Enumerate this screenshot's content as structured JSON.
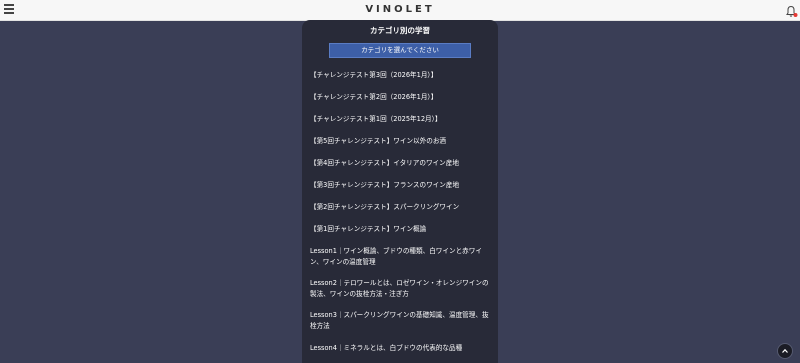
{
  "header": {
    "title": "VINOLET",
    "menu_icon": "hamburger-menu-icon",
    "bell_icon": "notification-bell-icon",
    "bell_badge_color": "#e53935"
  },
  "panel": {
    "title": "カテゴリ別の学習",
    "select_label": "カテゴリを選んでください",
    "accent_color": "#3d5fa8",
    "items": [
      {
        "label": "【チャレンジテスト第3回（2026年1月）】"
      },
      {
        "label": "【チャレンジテスト第2回（2026年1月）】"
      },
      {
        "label": "【チャレンジテスト第1回（2025年12月）】"
      },
      {
        "label": "【第5回チャレンジテスト】ワイン以外のお酒"
      },
      {
        "label": "【第4回チャレンジテスト】イタリアのワイン産地"
      },
      {
        "label": "【第3回チャレンジテスト】フランスのワイン産地"
      },
      {
        "label": "【第2回チャレンジテスト】スパークリングワイン"
      },
      {
        "label": "【第1回チャレンジテスト】ワイン概論"
      },
      {
        "label": "Lesson1｜ワイン概論、ブドウの種類、白ワインと赤ワイン、ワインの温度管理"
      },
      {
        "label": "Lesson2｜テロワールとは、ロゼワイン・オレンジワインの製法、ワインの抜栓方法・注ぎ方"
      },
      {
        "label": "Lesson3｜スパークリングワインの基礎知識、温度管理、抜栓方法"
      },
      {
        "label": "Lesson4｜ミネラルとは、白ブドウの代表的な品種"
      }
    ]
  },
  "scroll_top_icon": "chevron-up-icon"
}
